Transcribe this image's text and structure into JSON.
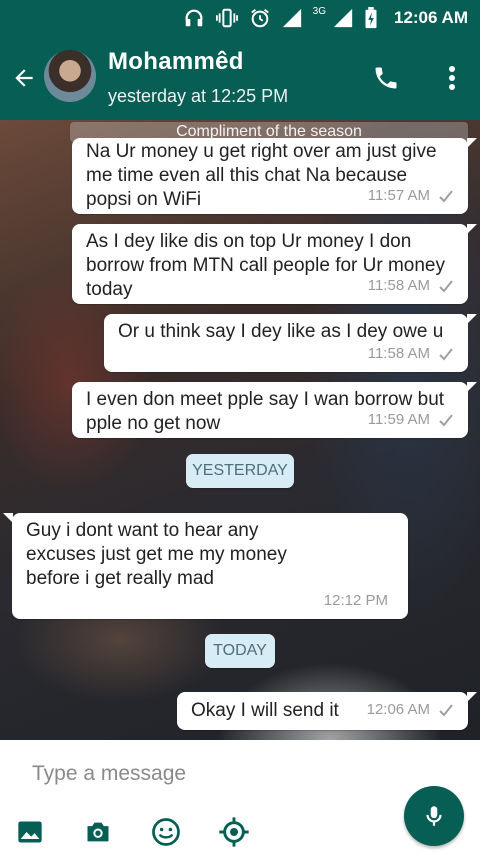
{
  "status_bar": {
    "network_label": "3G",
    "time": "12:06 AM"
  },
  "header": {
    "contact_name": "Mohammêd",
    "last_seen": "yesterday at 12:25 PM"
  },
  "chat": {
    "pinned_text": "Compliment of the season",
    "messages": [
      {
        "text": "Na Ur money u get right over am just give me time even all this chat Na because popsi on WiFi",
        "time": "11:57 AM",
        "direction": "outgoing"
      },
      {
        "text": "As I dey like dis on top Ur money I don borrow from MTN call people for Ur money today",
        "time": "11:58 AM",
        "direction": "outgoing"
      },
      {
        "text": "Or u think say I dey like as I dey owe u",
        "time": "11:58 AM",
        "direction": "outgoing"
      },
      {
        "text": "I even don meet pple say I wan borrow but pple no get now",
        "time": "11:59 AM",
        "direction": "outgoing"
      },
      {
        "text": "Guy i dont want to hear any excuses just get me my money before  i get really mad",
        "time": "12:12 PM",
        "direction": "incoming"
      },
      {
        "text": "Okay I will send it",
        "time": "12:06 AM",
        "direction": "outgoing"
      }
    ],
    "date_chips": [
      "YESTERDAY",
      "TODAY"
    ]
  },
  "input": {
    "placeholder": "Type a message"
  },
  "colors": {
    "primary": "#075e54",
    "date_chip_bg": "#d7ecf4",
    "bubble_bg": "#ffffff"
  }
}
